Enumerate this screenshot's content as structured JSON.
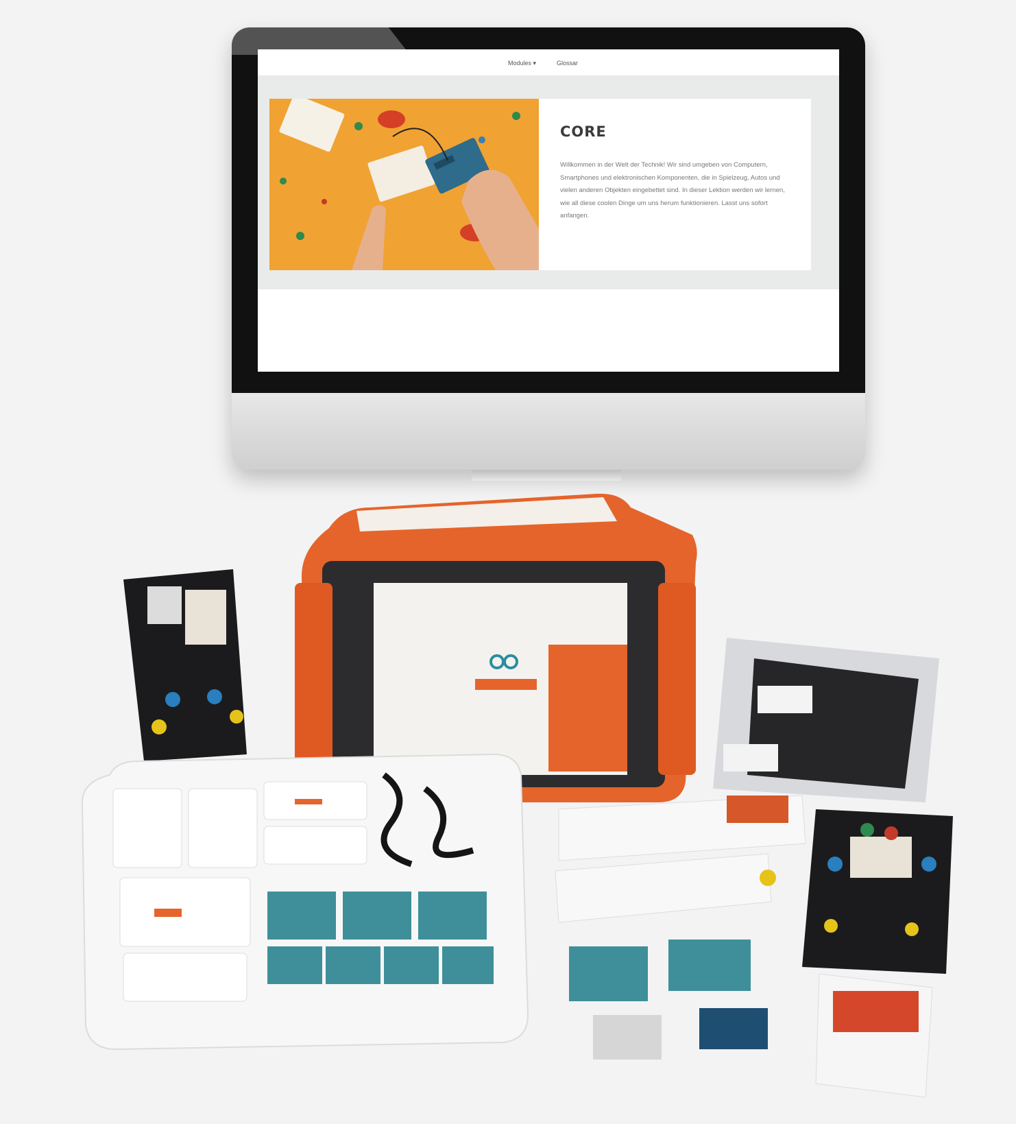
{
  "nav": {
    "modules_label": "Modules ▾",
    "glossar_label": "Glossar"
  },
  "lesson": {
    "title": "CORE",
    "text": "Willkommen in der Welt der Technik! Wir sind umgeben von Computern, Smartphones und elektronischen Komponenten, die in Spielzeug, Autos und vielen anderen Objekten eingebettet sind. In dieser Lektion werden wir lernen, wie all diese coolen Dinge um uns herum funktionieren. Lasst uns sofort anfangen."
  },
  "colors": {
    "accent_orange": "#f0a233",
    "kit_orange": "#e5642b",
    "board_teal": "#3e8f9a",
    "monitor_bezel": "#111111"
  },
  "icons": {
    "arduino_logo": "infinity-logo-icon"
  }
}
